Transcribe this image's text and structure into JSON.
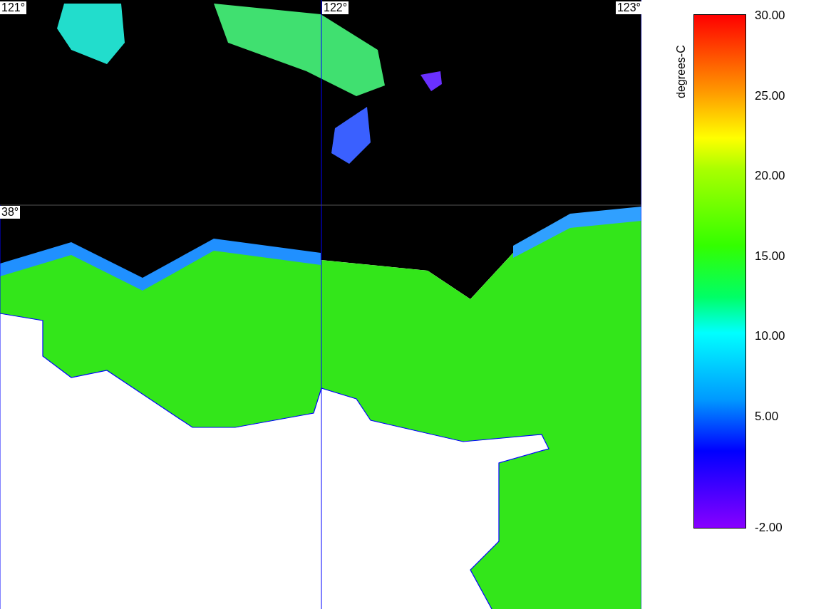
{
  "map": {
    "longitude_labels": [
      "121°",
      "122°",
      "123°"
    ],
    "latitude_labels": [
      "38°"
    ]
  },
  "colorbar": {
    "unit_label": "degrees-C",
    "ticks": [
      "30.00",
      "25.00",
      "20.00",
      "15.00",
      "10.00",
      "5.00",
      "-2.00"
    ]
  }
}
